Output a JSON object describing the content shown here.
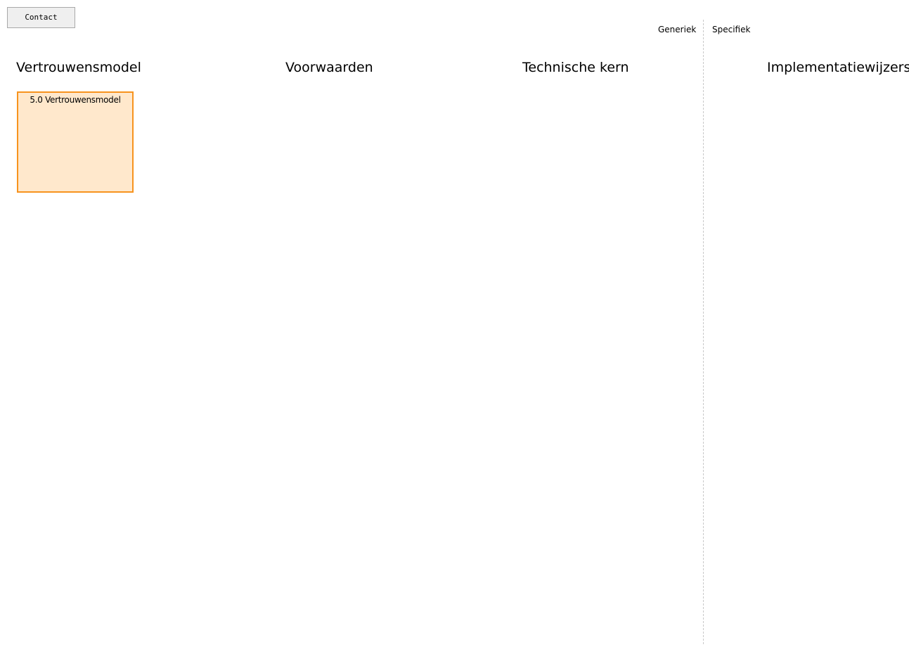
{
  "toolbar": {
    "contact_label": "Contact"
  },
  "zones": {
    "generic_label": "Generiek",
    "specific_label": "Specifiek"
  },
  "columns": {
    "vertrouwensmodel": "Vertrouwensmodel",
    "voorwaarden": "Voorwaarden",
    "technische_kern": "Technische kern",
    "implementatiewijzers": "Implementatiewijzers"
  },
  "modules": [
    {
      "title": "5.0 Vertrouwensmodel",
      "fill_color": "#ffe8cc",
      "border_color": "#f7931e"
    }
  ]
}
